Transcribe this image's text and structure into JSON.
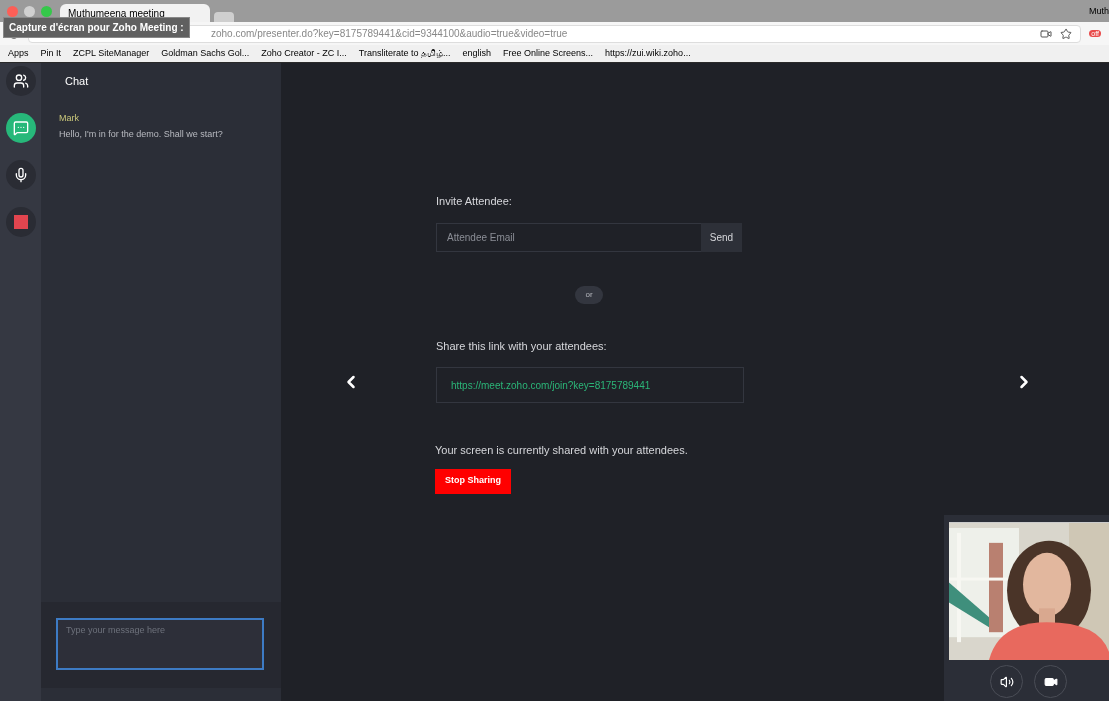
{
  "browser": {
    "tab_title": "Muthumeena meeting",
    "url": "zoho.com/presenter.do?key=8175789441&cid=9344100&audio=true&video=true",
    "profile": "Muth",
    "tooltip": "Capture d'écran pour Zoho Meeting :",
    "extension_badge": "off",
    "bookmarks": [
      "Apps",
      "Pin It",
      "ZCPL SiteManager",
      "Goldman Sachs Gol...",
      "Zoho Creator - ZC I...",
      "Transliterate to தமிழ்...",
      "english",
      "Free Online Screens...",
      "https://zui.wiki.zoho..."
    ]
  },
  "rail": [
    {
      "kind": "people",
      "selected": false
    },
    {
      "kind": "chat",
      "selected": true
    },
    {
      "kind": "mic",
      "selected": false
    },
    {
      "kind": "stop",
      "selected": false
    }
  ],
  "chat": {
    "title": "Chat",
    "messages": [
      {
        "author": "Mark",
        "text": "Hello, I'm in for the demo. Shall we start?"
      }
    ],
    "input": {
      "placeholder": "Type your message here"
    }
  },
  "invite": {
    "label": "Invite Attendee:",
    "email": {
      "placeholder": "Attendee Email"
    },
    "send": "Send",
    "separator": "or",
    "share_label": "Share this link with your attendees:",
    "link": "https://meet.zoho.com/join?key=8175789441",
    "status": "Your screen is currently shared with your attendees.",
    "stop": "Stop Sharing"
  }
}
